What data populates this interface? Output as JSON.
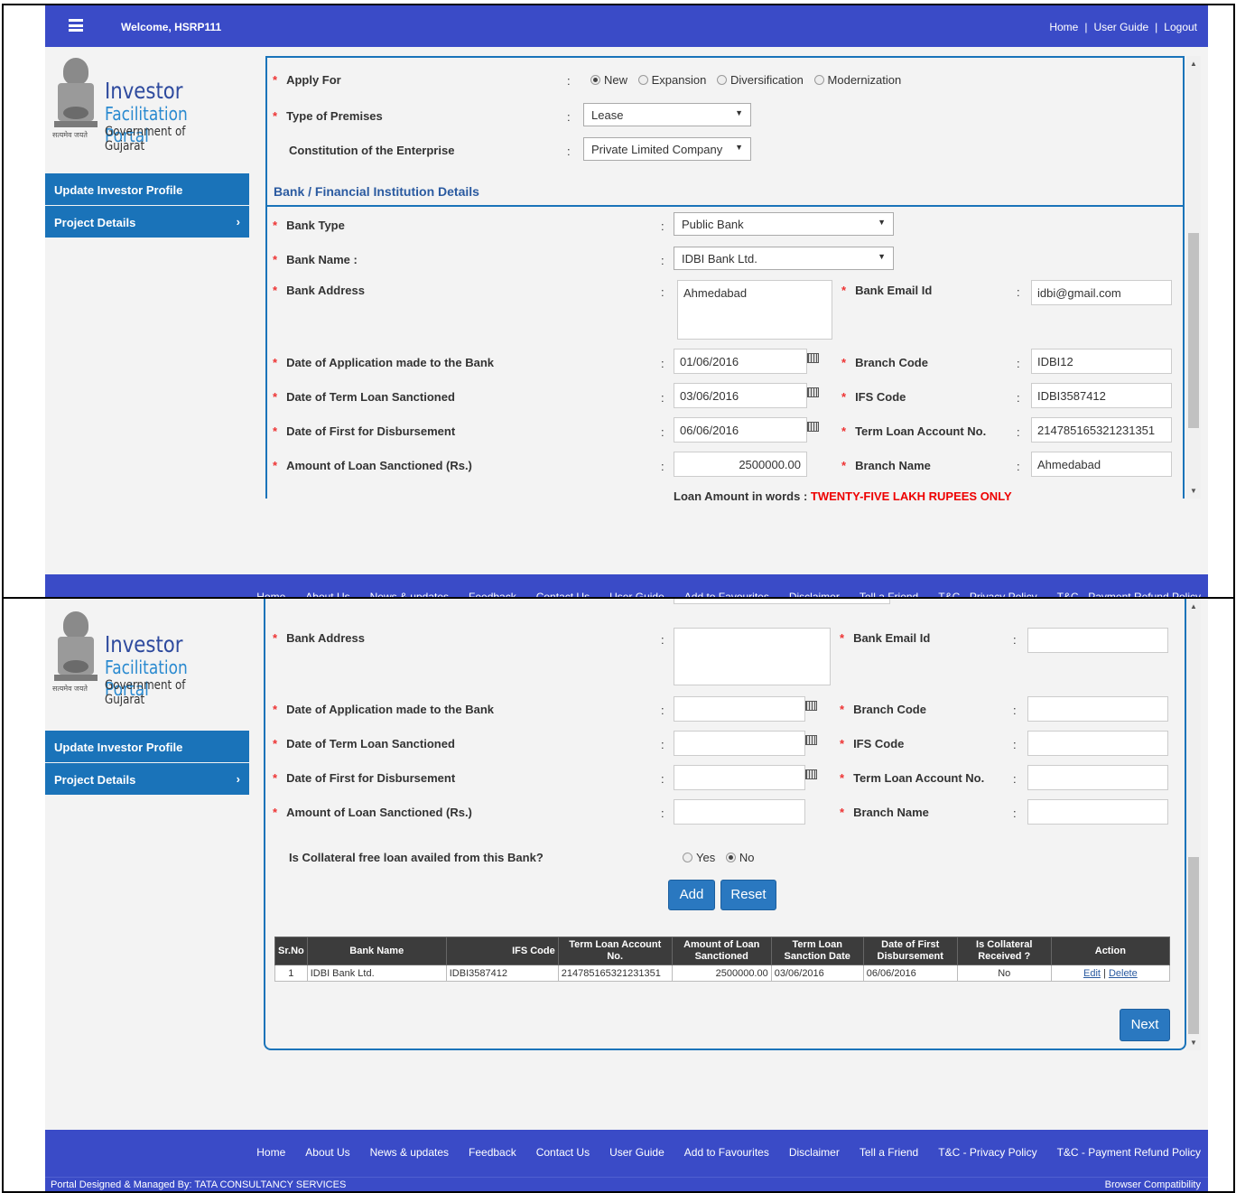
{
  "header": {
    "welcome": "Welcome, HSRP111",
    "home": "Home",
    "guide": "User Guide",
    "logout": "Logout",
    "sep": "|"
  },
  "logo": {
    "t1": "Investor",
    "t2": "Facilitation Portal",
    "t3": "Government of Gujarat",
    "motto": "सत्यमेव जयते"
  },
  "sidebar": {
    "update": "Update Investor Profile",
    "project": "Project Details",
    "chev": "›"
  },
  "form": {
    "apply_for": "Apply For",
    "apply_opts": [
      "New",
      "Expansion",
      "Diversification",
      "Modernization"
    ],
    "premises": "Type of Premises",
    "premises_val": "Lease",
    "constitution": "Constitution of the Enterprise",
    "constitution_val": "Private Limited Company",
    "section": "Bank / Financial Institution Details",
    "bank_type": "Bank Type",
    "bank_type_val": "Public Bank",
    "bank_name": "Bank Name :",
    "bank_name_val": "IDBI Bank Ltd.",
    "bank_addr": "Bank Address",
    "bank_addr_val": "Ahmedabad",
    "bank_email": "Bank Email Id",
    "bank_email_val": "idbi@gmail.com",
    "date_app": "Date of Application made to the Bank",
    "date_app_val": "01/06/2016",
    "branch_code": "Branch Code",
    "branch_code_val": "IDBI12",
    "date_term": "Date of Term Loan Sanctioned",
    "date_term_val": "03/06/2016",
    "ifs": "IFS Code",
    "ifs_val": "IDBI3587412",
    "date_first": "Date of First for Disbursement",
    "date_first_val": "06/06/2016",
    "term_acc": "Term Loan Account No.",
    "term_acc_val": "214785165321231351",
    "amount": "Amount of Loan Sanctioned (Rs.)",
    "amount_val": "2500000.00",
    "branch_name": "Branch Name",
    "branch_name_val": "Ahmedabad",
    "words_label": "Loan Amount in words :",
    "words_val": "TWENTY-FIVE LAKH RUPEES ONLY",
    "collateral_q": "Is Collateral free loan availed from this Bank?",
    "yes": "Yes",
    "no": "No",
    "colon": ":",
    "star": "*"
  },
  "buttons": {
    "add": "Add",
    "reset": "Reset",
    "next": "Next"
  },
  "table": {
    "headers": [
      "Sr.No",
      "Bank Name",
      "IFS Code",
      "Term Loan Account No.",
      "Amount of Loan Sanctioned",
      "Term Loan Sanction Date",
      "Date of First Disbursement",
      "Is Collateral Received ?",
      "Action"
    ],
    "row": {
      "sr": "1",
      "bank": "IDBI Bank Ltd.",
      "ifs": "IDBI3587412",
      "acc": "214785165321231351",
      "amt": "2500000.00",
      "sanc": "03/06/2016",
      "first": "06/06/2016",
      "coll": "No",
      "edit": "Edit",
      "sep": "|",
      "del": "Delete"
    }
  },
  "footer": {
    "links": [
      "Home",
      "About Us",
      "News & updates",
      "Feedback",
      "Contact Us",
      "User Guide",
      "Add to Favourites",
      "Disclaimer",
      "Tell a Friend",
      "T&C - Privacy Policy",
      "T&C - Payment Refund Policy"
    ],
    "designed": "Portal Designed & Managed By: TATA CONSULTANCY SERVICES",
    "compat": "Browser Compatibility"
  },
  "icons": {
    "scroll_up": "▲",
    "scroll_down": "▼",
    "caret": "▼"
  }
}
